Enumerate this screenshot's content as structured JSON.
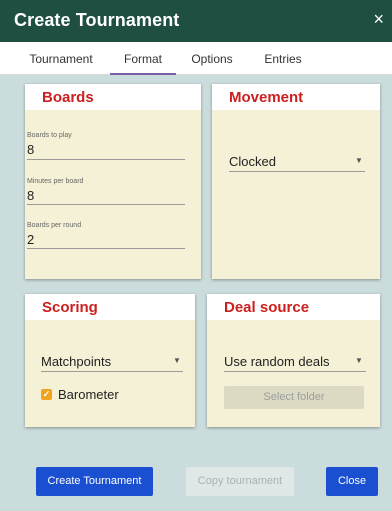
{
  "window": {
    "title": "Create Tournament",
    "close_glyph": "×"
  },
  "tabs": [
    {
      "label": "Tournament"
    },
    {
      "label": "Format",
      "active": true
    },
    {
      "label": "Options"
    },
    {
      "label": "Entries"
    }
  ],
  "boards": {
    "title": "Boards",
    "fields": [
      {
        "label": "Boards to play",
        "value": "8"
      },
      {
        "label": "Minutes per board",
        "value": "8"
      },
      {
        "label": "Boards per round",
        "value": "2"
      }
    ]
  },
  "movement": {
    "title": "Movement",
    "value": "Clocked"
  },
  "scoring": {
    "title": "Scoring",
    "value": "Matchpoints",
    "barometer_label": "Barometer",
    "barometer_checked": true
  },
  "deal_source": {
    "title": "Deal source",
    "value": "Use random deals",
    "select_folder_label": "Select folder"
  },
  "footer": {
    "create_label": "Create Tournament",
    "copy_label": "Copy tournament",
    "close_label": "Close"
  },
  "colors": {
    "title_bar": "#1f4f42",
    "card_title": "#cc1f1f",
    "card_bg": "#f5f1d6",
    "primary_button": "#1a4fd1",
    "checkbox": "#f0a31e",
    "active_tab_underline": "#7a5ea8",
    "page_bg": "#cbdcdc"
  },
  "icons": {
    "dropdown": "caret-down-icon",
    "close": "close-icon",
    "check": "checkmark-icon"
  }
}
